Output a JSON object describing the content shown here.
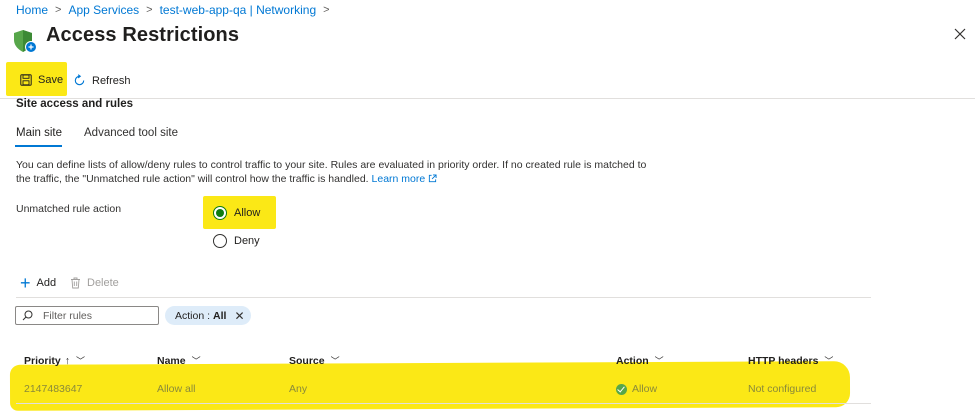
{
  "breadcrumb": [
    "Home",
    "App Services",
    "test-web-app-qa | Networking"
  ],
  "title": "Access Restrictions",
  "more": "···",
  "toolbar": {
    "save": "Save",
    "refresh": "Refresh"
  },
  "section_title": "Site access and rules",
  "tabs": [
    {
      "label": "Main site",
      "selected": true
    },
    {
      "label": "Advanced tool site",
      "selected": false
    }
  ],
  "description": "You can define lists of allow/deny rules to control traffic to your site. Rules are evaluated in priority order. If no created rule is matched to the traffic, the \"Unmatched rule action\" will control how the traffic is handled.",
  "learn_more": "Learn more",
  "unmatched_label": "Unmatched rule action",
  "radio": {
    "allow": "Allow",
    "deny": "Deny",
    "selected": "Allow"
  },
  "list_actions": {
    "add": "Add",
    "delete": "Delete"
  },
  "filter": {
    "placeholder": "Filter rules"
  },
  "pill": {
    "label": "Action :",
    "value": "All"
  },
  "table": {
    "headers": {
      "priority": "Priority",
      "priority_sort": "↑",
      "name": "Name",
      "source": "Source",
      "action": "Action",
      "http": "HTTP headers"
    },
    "rows": [
      {
        "priority": "2147483647",
        "name": "Allow all",
        "source": "Any",
        "action": "Allow",
        "http": "Not configured"
      }
    ]
  },
  "colors": {
    "accent": "#0078d4",
    "highlight": "#fbe816",
    "success": "#107c10"
  }
}
